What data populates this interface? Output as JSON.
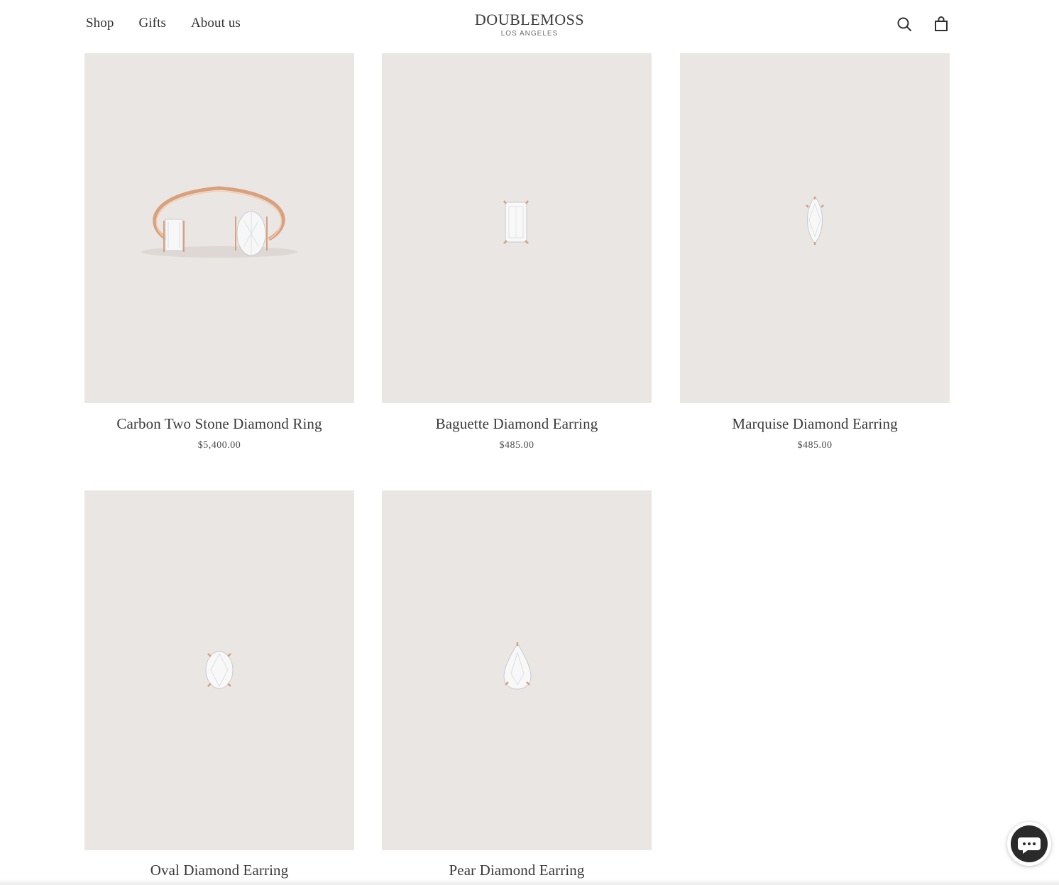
{
  "header": {
    "nav": [
      "Shop",
      "Gifts",
      "About us"
    ],
    "logo_main": "DOUBLEMOSS",
    "logo_sub": "LOS ANGELES",
    "icons": [
      "search-icon",
      "cart-icon"
    ]
  },
  "products": [
    {
      "name": "Carbon Two Stone Diamond Ring",
      "price": "$5,400.00"
    },
    {
      "name": "Baguette Diamond Earring",
      "price": "$485.00"
    },
    {
      "name": "Marquise Diamond Earring",
      "price": "$485.00"
    },
    {
      "name": "Oval Diamond Earring",
      "price": ""
    },
    {
      "name": "Pear Diamond Earring",
      "price": ""
    }
  ],
  "chat": {
    "icon": "chat-bubble-icon"
  },
  "colors": {
    "image_bg": "#eae6e3",
    "rose_gold": "#d9a07d",
    "text": "#3a3a3a"
  }
}
